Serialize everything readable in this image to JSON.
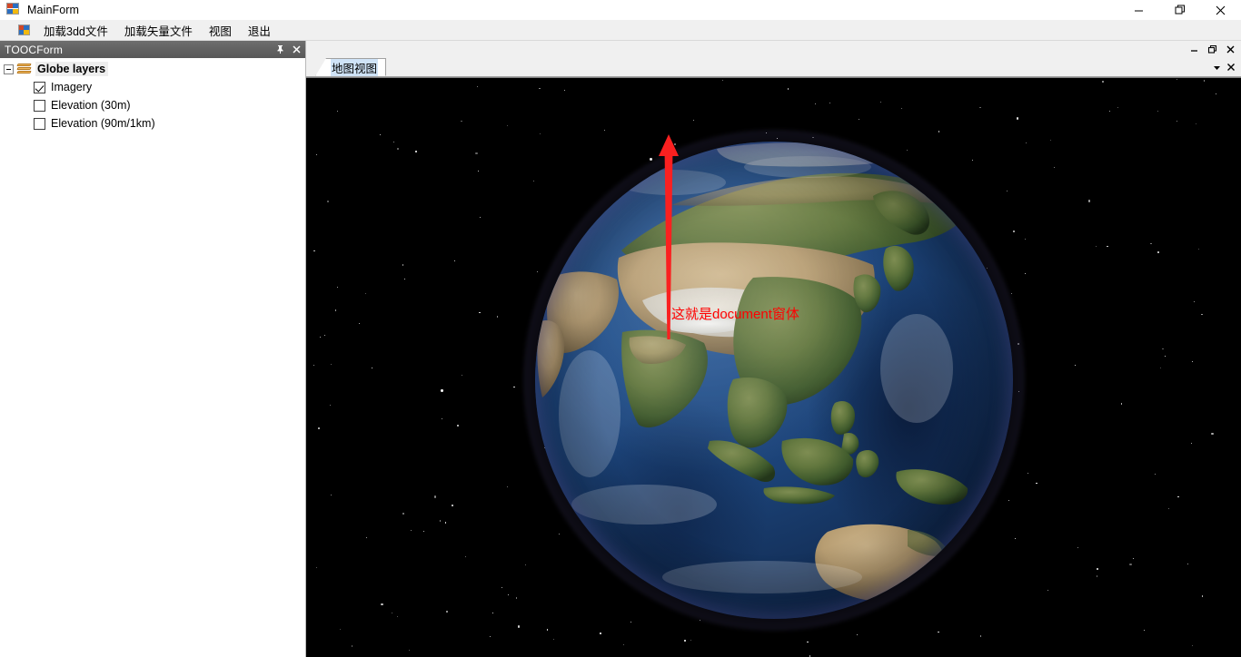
{
  "window": {
    "title": "MainForm",
    "icon": "vs-form-icon",
    "controls": [
      {
        "name": "minimize",
        "label": "–"
      },
      {
        "name": "maximize",
        "label": "❐"
      },
      {
        "name": "close",
        "label": "✕"
      }
    ]
  },
  "menubar": {
    "icon": "vs-form-icon",
    "items": [
      {
        "label": "加载3dd文件"
      },
      {
        "label": "加载矢量文件"
      },
      {
        "label": "视图"
      },
      {
        "label": "退出"
      }
    ]
  },
  "toc_panel": {
    "title": "TOOCForm",
    "pin_icon": "pin-icon",
    "close_icon": "close-icon",
    "tree": {
      "root": {
        "label": "Globe layers",
        "icon": "layers-icon",
        "expanded": true
      },
      "children": [
        {
          "label": "Imagery",
          "checked": true
        },
        {
          "label": "Elevation (30m)",
          "checked": false
        },
        {
          "label": "Elevation (90m/1km)",
          "checked": false
        }
      ]
    }
  },
  "mdi": {
    "controls": [
      {
        "name": "mdi-minimize",
        "label": "–"
      },
      {
        "name": "mdi-restore",
        "label": "❐"
      },
      {
        "name": "mdi-close",
        "label": "✕"
      }
    ],
    "tab": {
      "label": "地图视图",
      "selected": true
    },
    "tab_controls": [
      {
        "name": "tab-list-dropdown",
        "label": "▾"
      },
      {
        "name": "tab-close",
        "label": "✕"
      }
    ]
  },
  "mapview": {
    "background_color": "#000000",
    "globe": {
      "name": "earth-globe",
      "view_center": "Asia",
      "halo_color": "#8f86cd",
      "ocean_color": "#1b4175",
      "land_color": "#5c7a3d"
    }
  },
  "annotation": {
    "text": "这就是document窗体",
    "color": "#ff0000",
    "arrow": "up-arrow"
  }
}
